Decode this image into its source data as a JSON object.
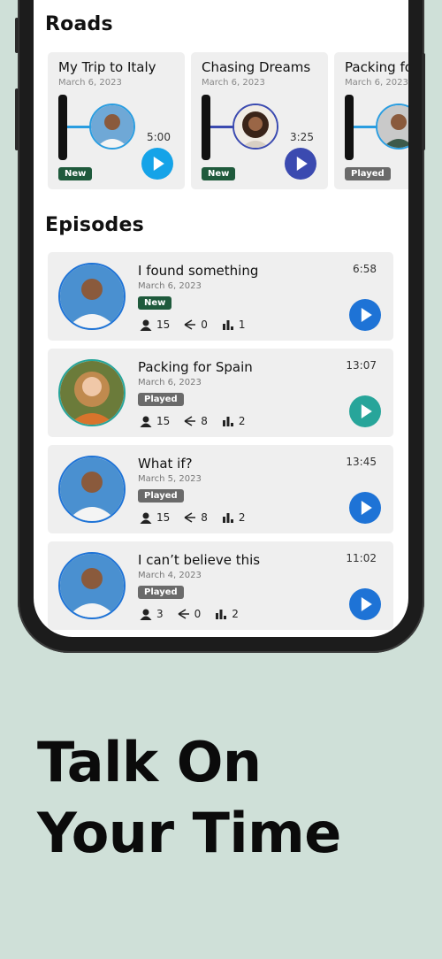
{
  "roads_heading": "Roads",
  "episodes_heading": "Episodes",
  "roads": [
    {
      "title": "My Trip to Italy",
      "date": "March 6, 2023",
      "duration": "5:00",
      "status": "New",
      "accent": "#2a9de0",
      "avatar": "man-avatar"
    },
    {
      "title": "Chasing Dreams",
      "date": "March 6, 2023",
      "duration": "3:25",
      "status": "New",
      "accent": "#3b4ab0",
      "avatar": "woman-avatar"
    },
    {
      "title": "Packing for Spain",
      "date": "March 6, 2023",
      "duration": "",
      "status": "Played",
      "accent": "#2a9de0",
      "avatar": "man-avatar"
    }
  ],
  "episodes": [
    {
      "title": "I found something",
      "date": "March 6, 2023",
      "duration": "6:58",
      "status": "New",
      "listeners": "15",
      "shares": "0",
      "plays": "1",
      "accent": "#1e73d6"
    },
    {
      "title": "Packing for Spain",
      "date": "March 6, 2023",
      "duration": "13:07",
      "status": "Played",
      "listeners": "15",
      "shares": "8",
      "plays": "2",
      "accent": "#27a59a"
    },
    {
      "title": "What if?",
      "date": "March 5, 2023",
      "duration": "13:45",
      "status": "Played",
      "listeners": "15",
      "shares": "8",
      "plays": "2",
      "accent": "#1e73d6"
    },
    {
      "title": "I can’t believe this",
      "date": "March 4, 2023",
      "duration": "11:02",
      "status": "Played",
      "listeners": "3",
      "shares": "0",
      "plays": "2",
      "accent": "#1e73d6"
    }
  ],
  "tagline": {
    "line1": "Talk On",
    "line2": "Your Time"
  }
}
